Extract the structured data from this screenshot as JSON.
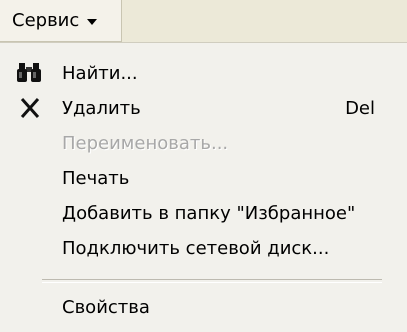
{
  "menu": {
    "title": "Сервис",
    "items": [
      {
        "label": "Найти...",
        "icon": "binoculars-icon",
        "shortcut": "",
        "enabled": true
      },
      {
        "label": "Удалить",
        "icon": "delete-x-icon",
        "shortcut": "Del",
        "enabled": true
      },
      {
        "label": "Переименовать...",
        "icon": "",
        "shortcut": "",
        "enabled": false
      },
      {
        "label": "Печать",
        "icon": "",
        "shortcut": "",
        "enabled": true
      },
      {
        "label": "Добавить в папку \"Избранное\"",
        "icon": "",
        "shortcut": "",
        "enabled": true
      },
      {
        "label": "Подключить сетевой диск...",
        "icon": "",
        "shortcut": "",
        "enabled": true
      },
      {
        "label": "Свойства",
        "icon": "",
        "shortcut": "",
        "enabled": true
      }
    ]
  }
}
